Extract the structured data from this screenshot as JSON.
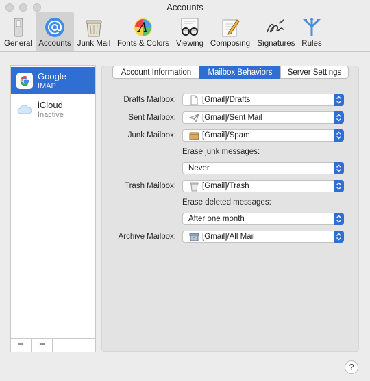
{
  "window": {
    "title": "Accounts"
  },
  "toolbar": {
    "items": [
      {
        "label": "General",
        "icon": "general-switch-icon"
      },
      {
        "label": "Accounts",
        "icon": "at-sign-icon"
      },
      {
        "label": "Junk Mail",
        "icon": "trash-bin-icon"
      },
      {
        "label": "Fonts & Colors",
        "icon": "font-a-icon"
      },
      {
        "label": "Viewing",
        "icon": "glasses-icon"
      },
      {
        "label": "Composing",
        "icon": "pencil-paper-icon"
      },
      {
        "label": "Signatures",
        "icon": "signature-icon"
      },
      {
        "label": "Rules",
        "icon": "rules-arrows-icon"
      }
    ]
  },
  "sidebar": {
    "accounts": [
      {
        "name": "Google",
        "subtitle": "IMAP"
      },
      {
        "name": "iCloud",
        "subtitle": "Inactive"
      }
    ],
    "add_label": "+",
    "remove_label": "−"
  },
  "tabs": [
    "Account Information",
    "Mailbox Behaviors",
    "Server Settings"
  ],
  "form": {
    "drafts": {
      "label": "Drafts Mailbox:",
      "value": "[Gmail]/Drafts"
    },
    "sent": {
      "label": "Sent Mailbox:",
      "value": "[Gmail]/Sent Mail"
    },
    "junk": {
      "label": "Junk Mailbox:",
      "value": "[Gmail]/Spam"
    },
    "erase_junk": {
      "label": "Erase junk messages:",
      "value": "Never"
    },
    "trash": {
      "label": "Trash Mailbox:",
      "value": "[Gmail]/Trash"
    },
    "erase_deleted": {
      "label": "Erase deleted messages:",
      "value": "After one month"
    },
    "archive": {
      "label": "Archive Mailbox:",
      "value": "[Gmail]/All Mail"
    }
  },
  "help": {
    "label": "?"
  },
  "colors": {
    "accent": "#2f6ed3",
    "window_bg": "#ececec",
    "panel_bg": "#e3e3e3"
  }
}
